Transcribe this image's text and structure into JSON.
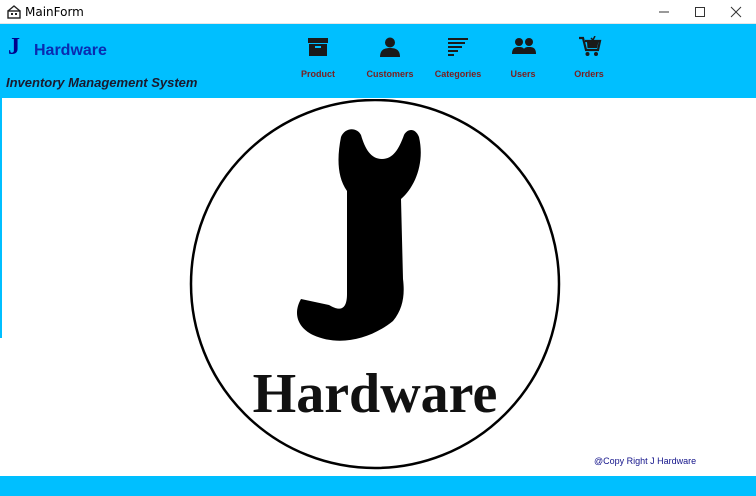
{
  "window": {
    "title": "MainForm"
  },
  "header": {
    "brand_letter": "J",
    "brand_name": "Hardware",
    "subtitle": "Inventory Management System"
  },
  "nav": [
    {
      "label": "Product",
      "icon": "box-icon"
    },
    {
      "label": "Customers",
      "icon": "person-icon"
    },
    {
      "label": "Categories",
      "icon": "list-lines-icon"
    },
    {
      "label": "Users",
      "icon": "users-group-icon"
    },
    {
      "label": "Orders",
      "icon": "shopping-cart-icon"
    }
  ],
  "logo": {
    "text": "Hardware"
  },
  "footer": {
    "copyright": "@Copy Right J Hardware"
  },
  "colors": {
    "header_bg": "#00bfff",
    "brand": "#0a2bb0",
    "nav_label": "#7a1e1e",
    "icon": "#1a1a1a"
  }
}
